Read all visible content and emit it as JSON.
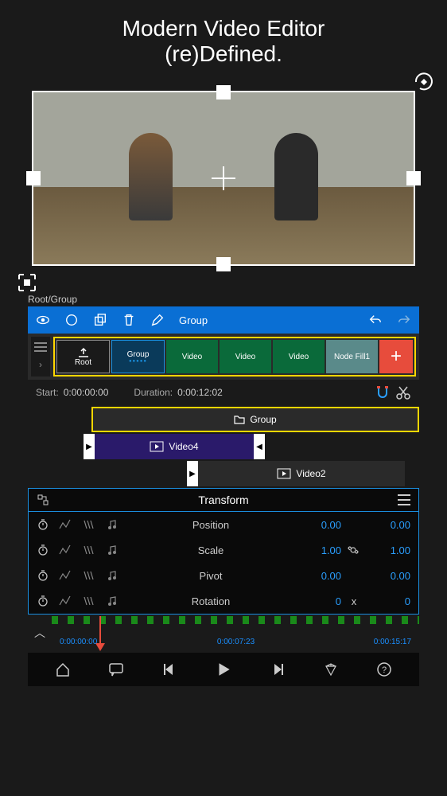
{
  "headline": {
    "line1": "Modern Video Editor",
    "line2": "(re)Defined."
  },
  "breadcrumb": "Root/Group",
  "toolbar": {
    "group_label": "Group",
    "icons": {
      "eye": "eye-icon",
      "out": "out-icon",
      "copy": "copy-icon",
      "trash": "trash-icon",
      "edit": "edit-icon",
      "undo": "undo-icon",
      "redo": "redo-icon"
    }
  },
  "clips": {
    "root": "Root",
    "group": "Group",
    "video": "Video",
    "nodefill": "Node Fill1",
    "add": "+"
  },
  "meta": {
    "start_label": "Start:",
    "start_value": "0:00:00:00",
    "duration_label": "Duration:",
    "duration_value": "0:00:12:02"
  },
  "tracks": {
    "group": "Group",
    "video4": "Video4",
    "video2": "Video2"
  },
  "transform": {
    "title": "Transform",
    "rows": [
      {
        "prop": "Position",
        "v1": "0.00",
        "link": "",
        "v2": "0.00"
      },
      {
        "prop": "Scale",
        "v1": "1.00",
        "link": "link",
        "v2": "1.00"
      },
      {
        "prop": "Pivot",
        "v1": "0.00",
        "link": "",
        "v2": "0.00"
      },
      {
        "prop": "Rotation",
        "v1": "0",
        "link": "x",
        "v2": "0"
      }
    ]
  },
  "ruler": {
    "t0": "0:00:00:00",
    "t1": "0:00:07:23",
    "t2": "0:00:15:17"
  }
}
